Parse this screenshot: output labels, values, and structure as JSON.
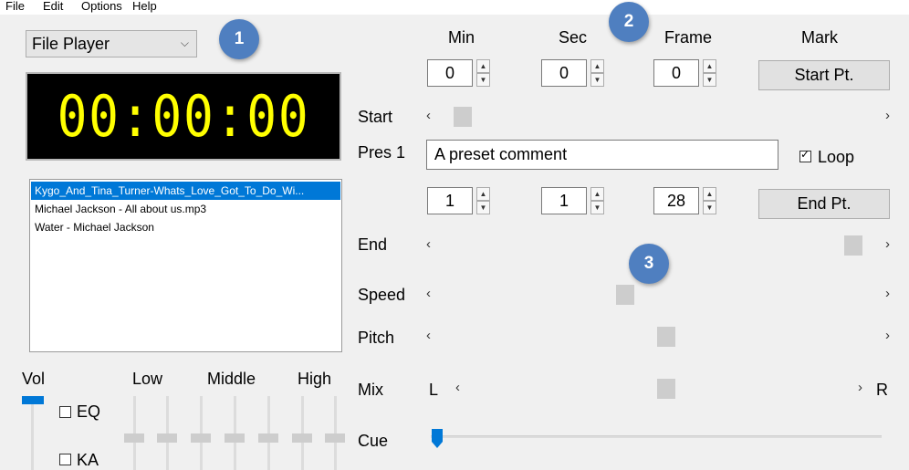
{
  "menu": [
    "File",
    "Edit",
    "Options",
    "Help"
  ],
  "player": {
    "source": "File Player",
    "time": "00:00:00",
    "playlist": [
      "Kygo_And_Tina_Turner-Whats_Love_Got_To_Do_Wi...",
      "Michael Jackson - All about us.mp3",
      "Water - Michael Jackson"
    ],
    "selected_index": 0
  },
  "badges": [
    "1",
    "2",
    "3"
  ],
  "columns": {
    "min": "Min",
    "sec": "Sec",
    "frame": "Frame",
    "mark": "Mark"
  },
  "start": {
    "min": "0",
    "sec": "0",
    "frame": "0",
    "button": "Start Pt.",
    "label": "Start",
    "position": 0.03
  },
  "preset": {
    "label": "Pres 1",
    "comment": "A preset comment",
    "loop_label": "Loop",
    "loop_checked": true
  },
  "end": {
    "min": "1",
    "sec": "1",
    "frame": "28",
    "button": "End Pt.",
    "label": "End",
    "position": 0.97
  },
  "speed": {
    "label": "Speed",
    "position": 0.42
  },
  "pitch": {
    "label": "Pitch",
    "position": 0.52
  },
  "mix": {
    "label": "Mix",
    "left": "L",
    "right": "R",
    "position": 0.52
  },
  "cue": {
    "label": "Cue",
    "position": 0.0
  },
  "mixer": {
    "vol_label": "Vol",
    "low_label": "Low",
    "middle_label": "Middle",
    "high_label": "High",
    "eq_label": "EQ",
    "eq_checked": false,
    "ka_label": "KA",
    "ka_checked": false
  },
  "colors": {
    "accent": "#0078d7",
    "display_text": "#ffff00",
    "badge": "#4f7fc0"
  },
  "icons": {
    "dropdown": "chevron-down-icon",
    "spin_up": "up-arrow-icon",
    "spin_down": "down-arrow-icon",
    "scroll_left": "chevron-left-icon",
    "scroll_right": "chevron-right-icon"
  }
}
